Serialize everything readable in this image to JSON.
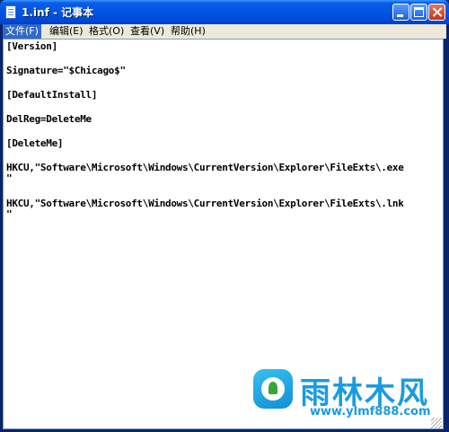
{
  "window": {
    "title": "1.inf - 记事本"
  },
  "menu": [
    {
      "label": "文件(F)"
    },
    {
      "label": "编辑(E)"
    },
    {
      "label": "格式(O)"
    },
    {
      "label": "查看(V)"
    },
    {
      "label": "帮助(H)"
    }
  ],
  "document": {
    "lines": [
      "[Version]",
      "Signature=\"$Chicago$\"",
      "[DefaultInstall]",
      "DelReg=DeleteMe",
      "[DeleteMe]",
      "HKCU,\"Software\\Microsoft\\Windows\\CurrentVersion\\Explorer\\FileExts\\.exe",
      "\"",
      "HKCU,\"Software\\Microsoft\\Windows\\CurrentVersion\\Explorer\\FileExts\\.lnk",
      "\""
    ]
  },
  "watermark": {
    "brand": "雨林木风",
    "url": "www.ylmf888.com"
  },
  "colors": {
    "titlebar": "#0055e5",
    "menu_bg": "#ece9d8",
    "menu_active": "#316ac5",
    "watermark": "#1a9be0"
  }
}
